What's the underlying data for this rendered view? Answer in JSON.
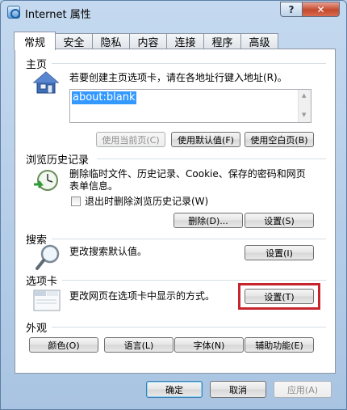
{
  "window": {
    "title": "Internet 属性",
    "help_label": "?",
    "close_label": "✕"
  },
  "tabs": [
    "常规",
    "安全",
    "隐私",
    "内容",
    "连接",
    "程序",
    "高级"
  ],
  "home": {
    "label": "主页",
    "description": "若要创建主页选项卡，请在各地址行键入地址(R)。",
    "value": "about:blank",
    "buttons": {
      "current": "使用当前页(C)",
      "default": "使用默认值(F)",
      "blank": "使用空白页(B)"
    }
  },
  "history": {
    "label": "浏览历史记录",
    "description_line1": "删除临时文件、历史记录、Cookie、保存的密码和网页",
    "description_line2": "表单信息。",
    "checkbox_label": "退出时删除浏览历史记录(W)",
    "delete_label": "删除(D)...",
    "settings_label": "设置(S)"
  },
  "search": {
    "label": "搜索",
    "description": "更改搜索默认值。",
    "settings_label": "设置(I)"
  },
  "tabs_group": {
    "label": "选项卡",
    "description": "更改网页在选项卡中显示的方式。",
    "settings_label": "设置(T)"
  },
  "appearance": {
    "label": "外观",
    "colors_label": "颜色(O)",
    "languages_label": "语言(L)",
    "fonts_label": "字体(N)",
    "accessibility_label": "辅助功能(E)"
  },
  "footer": {
    "ok_label": "确定",
    "cancel_label": "取消",
    "apply_label": "应用(A)"
  },
  "colors": {
    "highlight_border": "#c6252e",
    "selection": "#3399ff"
  }
}
